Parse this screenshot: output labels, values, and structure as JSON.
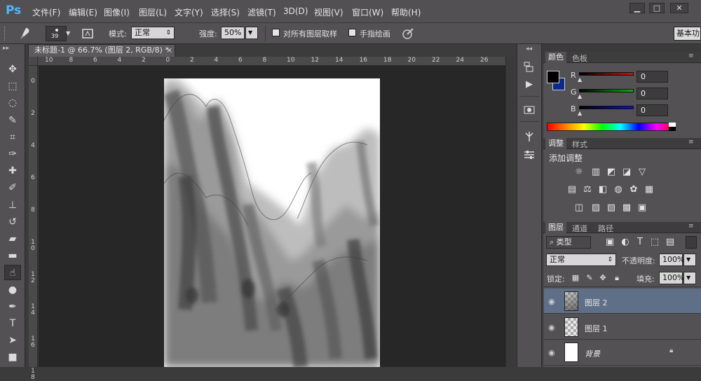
{
  "app": {
    "logo": "Ps"
  },
  "menu": [
    "文件(F)",
    "编辑(E)",
    "图像(I)",
    "图层(L)",
    "文字(Y)",
    "选择(S)",
    "滤镜(T)",
    "3D(D)",
    "视图(V)",
    "窗口(W)",
    "帮助(H)"
  ],
  "window_controls": {
    "minimize": "▁",
    "maximize": "□",
    "close": "✕"
  },
  "options": {
    "brush_size": "39",
    "mode_label": "模式:",
    "mode_value": "正常",
    "strength_label": "强度:",
    "strength_value": "50%",
    "sample_all_label": "对所有图层取样",
    "finger_paint_label": "手指绘画",
    "workspace": "基本功"
  },
  "document": {
    "tab_title": "未标题-1 @ 66.7% (图层 2, RGB/8) *",
    "close": "×",
    "ruler_top": [
      "10",
      "8",
      "6",
      "4",
      "2",
      "0",
      "2",
      "4",
      "6",
      "8",
      "10",
      "12",
      "14",
      "16",
      "18",
      "20",
      "22",
      "24",
      "26"
    ],
    "ruler_left": [
      "0",
      "2",
      "4",
      "6",
      "8",
      "1 0",
      "1 2",
      "1 4",
      "1 6",
      "1 8"
    ]
  },
  "toolbox": [
    "move-tool-icon",
    "marquee-tool-icon",
    "lasso-tool-icon",
    "quick-select-tool-icon",
    "crop-tool-icon",
    "eyedropper-tool-icon",
    "healing-tool-icon",
    "brush-tool-icon",
    "stamp-tool-icon",
    "history-brush-tool-icon",
    "eraser-tool-icon",
    "gradient-tool-icon",
    "smudge-tool-icon",
    "dodge-tool-icon",
    "pen-tool-icon",
    "type-tool-icon",
    "path-select-tool-icon",
    "shape-tool-icon"
  ],
  "color_panel": {
    "tabs": [
      "颜色",
      "色板"
    ],
    "channels": [
      {
        "label": "R",
        "value": "0",
        "color": "#d01010"
      },
      {
        "label": "G",
        "value": "0",
        "color": "#10b010"
      },
      {
        "label": "B",
        "value": "0",
        "color": "#1010d0"
      }
    ],
    "foreground": "#000000",
    "background": "#0a2a8a"
  },
  "adjust_panel": {
    "tabs": [
      "调整",
      "样式"
    ],
    "title": "添加调整"
  },
  "layers_panel": {
    "tabs": [
      "图层",
      "通道",
      "路径"
    ],
    "filter_kind": "类型",
    "blend_mode": "正常",
    "opacity_label": "不透明度:",
    "opacity_value": "100%",
    "lock_label": "锁定:",
    "fill_label": "填充:",
    "fill_value": "100%",
    "layers": [
      {
        "name": "图层 2",
        "selected": true
      },
      {
        "name": "图层 1",
        "selected": false
      },
      {
        "name": "背景",
        "selected": false,
        "locked": true
      }
    ]
  }
}
